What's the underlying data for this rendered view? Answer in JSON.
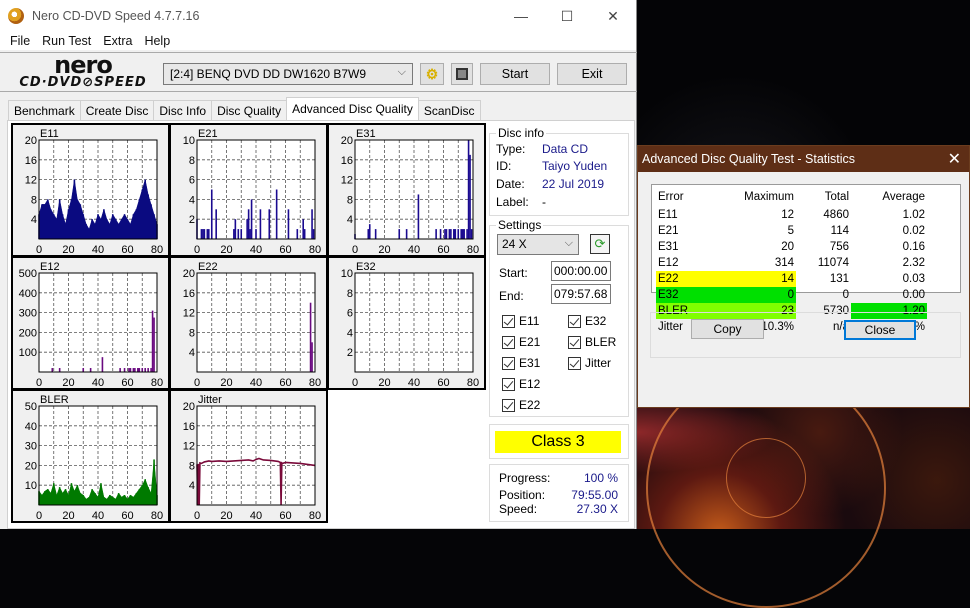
{
  "window": {
    "title": "Nero CD-DVD Speed 4.7.7.16",
    "minimize": "—",
    "maximize": "☐",
    "close": "✕"
  },
  "menu": [
    "File",
    "Run Test",
    "Extra",
    "Help"
  ],
  "logo": {
    "top": "nero",
    "bottom": "CD·DVD⊘SPEED"
  },
  "toolbar": {
    "drive": "[2:4]  BENQ DVD DD DW1620 B7W9",
    "start": "Start",
    "exit": "Exit",
    "icons": [
      "drive-settings-icon",
      "save-icon"
    ]
  },
  "tabs": [
    {
      "label": "Benchmark",
      "active": false
    },
    {
      "label": "Create Disc",
      "active": false
    },
    {
      "label": "Disc Info",
      "active": false
    },
    {
      "label": "Disc Quality",
      "active": false
    },
    {
      "label": "Advanced Disc Quality",
      "active": true
    },
    {
      "label": "ScanDisc",
      "active": false
    }
  ],
  "disc_info": {
    "title": "Disc info",
    "type_label": "Type:",
    "type": "Data CD",
    "id_label": "ID:",
    "id": "Taiyo Yuden",
    "date_label": "Date:",
    "date": "22 Jul 2019",
    "label_label": "Label:",
    "label": "-"
  },
  "settings": {
    "title": "Settings",
    "speed": "24 X",
    "start_label": "Start:",
    "start": "000:00.00",
    "end_label": "End:",
    "end": "079:57.68",
    "checks": [
      {
        "label": "E11",
        "checked": true
      },
      {
        "label": "E21",
        "checked": true
      },
      {
        "label": "E31",
        "checked": true
      },
      {
        "label": "E12",
        "checked": true
      },
      {
        "label": "E22",
        "checked": true
      },
      {
        "label": "E32",
        "checked": true
      },
      {
        "label": "BLER",
        "checked": true
      },
      {
        "label": "Jitter",
        "checked": true
      }
    ]
  },
  "class": {
    "label": "Class 3",
    "color": "#ffff00"
  },
  "progress": {
    "progress_label": "Progress:",
    "progress": "100 %",
    "position_label": "Position:",
    "position": "79:55.00",
    "speed_label": "Speed:",
    "speed": "27.30 X"
  },
  "dialog": {
    "title": "Advanced Disc Quality Test - Statistics",
    "close": "✕",
    "headers": [
      "Error",
      "Maximum",
      "Total",
      "Average"
    ],
    "rows": [
      {
        "name": "E11",
        "max": "12",
        "total": "4860",
        "avg": "1.02",
        "max_color": "",
        "avg_color": ""
      },
      {
        "name": "E21",
        "max": "5",
        "total": "114",
        "avg": "0.02",
        "max_color": "",
        "avg_color": ""
      },
      {
        "name": "E31",
        "max": "20",
        "total": "756",
        "avg": "0.16",
        "max_color": "",
        "avg_color": ""
      },
      {
        "name": "E12",
        "max": "314",
        "total": "11074",
        "avg": "2.32",
        "max_color": "",
        "avg_color": ""
      },
      {
        "name": "E22",
        "max": "14",
        "total": "131",
        "avg": "0.03",
        "max_color": "#ffff00",
        "avg_color": ""
      },
      {
        "name": "E32",
        "max": "0",
        "total": "0",
        "avg": "0.00",
        "max_color": "#00e000",
        "avg_color": ""
      },
      {
        "name": "BLER",
        "max": "23",
        "total": "5730",
        "avg": "1.20",
        "max_color": "#80ff00",
        "avg_color": "#00e000"
      },
      {
        "name": "Jitter",
        "max": "10.3%",
        "total": "n/a",
        "avg": "8.73%",
        "max_color": "",
        "avg_color": ""
      }
    ],
    "copy": "Copy",
    "close_btn": "Close"
  },
  "chart_data": [
    {
      "type": "bar",
      "title": "E11",
      "color": "#0a0a80",
      "xlim": [
        0,
        80
      ],
      "ylim": [
        0,
        20
      ],
      "xticks": [
        "0",
        "20",
        "40",
        "60",
        "80"
      ],
      "yticks": [
        "4",
        "8",
        "12",
        "16",
        "20"
      ],
      "x": [
        0,
        2,
        4,
        6,
        8,
        10,
        12,
        14,
        16,
        18,
        20,
        22,
        24,
        26,
        28,
        30,
        32,
        34,
        36,
        38,
        40,
        42,
        44,
        46,
        48,
        50,
        52,
        54,
        56,
        58,
        60,
        62,
        64,
        66,
        68,
        70,
        72,
        74,
        76,
        78,
        80
      ],
      "values": [
        5,
        7,
        7,
        8,
        6,
        5,
        4,
        8,
        5,
        3,
        6,
        8,
        12,
        8,
        7,
        5,
        3,
        2,
        4,
        3,
        5,
        4,
        6,
        4,
        3,
        5,
        4,
        3,
        4,
        5,
        4,
        3,
        5,
        6,
        8,
        10,
        12,
        9,
        7,
        5,
        3
      ]
    },
    {
      "type": "bar",
      "title": "E21",
      "color": "#1a0a90",
      "xlim": [
        0,
        80
      ],
      "ylim": [
        0,
        10
      ],
      "xticks": [
        "0",
        "20",
        "40",
        "60",
        "80"
      ],
      "yticks": [
        "2",
        "4",
        "6",
        "8",
        "10"
      ],
      "x": [
        0,
        3,
        4,
        5,
        7,
        8,
        10,
        13,
        25,
        26,
        28,
        30,
        34,
        35,
        36,
        37,
        40,
        43,
        49,
        54,
        62,
        68,
        72,
        73,
        78,
        79
      ],
      "values": [
        2,
        1,
        1,
        1,
        1,
        1,
        5,
        3,
        1,
        2,
        1,
        1,
        2,
        3,
        1,
        4,
        1,
        3,
        3,
        5,
        3,
        1,
        2,
        1,
        3,
        1
      ]
    },
    {
      "type": "bar",
      "title": "E31",
      "color": "#1a0a90",
      "xlim": [
        0,
        80
      ],
      "ylim": [
        0,
        20
      ],
      "xticks": [
        "0",
        "20",
        "40",
        "60",
        "80"
      ],
      "yticks": [
        "4",
        "8",
        "12",
        "16",
        "20"
      ],
      "x": [
        0,
        9,
        10,
        14,
        30,
        35,
        43,
        55,
        58,
        61,
        62,
        64,
        65,
        67,
        68,
        70,
        72,
        73,
        74,
        76,
        77,
        78,
        79
      ],
      "values": [
        1,
        2,
        3,
        2,
        2,
        2,
        9,
        2,
        2,
        2,
        2,
        2,
        2,
        2,
        2,
        2,
        2,
        2,
        2,
        2,
        20,
        17,
        2
      ]
    },
    {
      "type": "bar",
      "title": "E12",
      "color": "#6a0a80",
      "xlim": [
        0,
        80
      ],
      "ylim": [
        0,
        500
      ],
      "xticks": [
        "0",
        "20",
        "40",
        "60",
        "80"
      ],
      "yticks": [
        "100",
        "200",
        "300",
        "400",
        "500"
      ],
      "x": [
        9,
        14,
        30,
        35,
        43,
        55,
        58,
        61,
        62,
        64,
        65,
        67,
        68,
        70,
        72,
        74,
        76,
        77,
        78
      ],
      "values": [
        20,
        20,
        20,
        20,
        75,
        20,
        20,
        20,
        20,
        20,
        20,
        20,
        20,
        20,
        20,
        20,
        20,
        310,
        275
      ]
    },
    {
      "type": "bar",
      "title": "E22",
      "color": "#6a0a80",
      "xlim": [
        0,
        80
      ],
      "ylim": [
        0,
        20
      ],
      "xticks": [
        "0",
        "20",
        "40",
        "60",
        "80"
      ],
      "yticks": [
        "4",
        "8",
        "12",
        "16",
        "20"
      ],
      "x": [
        77,
        78
      ],
      "values": [
        14,
        6
      ]
    },
    {
      "type": "bar",
      "title": "E32",
      "color": "#1a0a90",
      "xlim": [
        0,
        80
      ],
      "ylim": [
        0,
        10
      ],
      "xticks": [
        "0",
        "20",
        "40",
        "60",
        "80"
      ],
      "yticks": [
        "2",
        "4",
        "6",
        "8",
        "10"
      ],
      "x": [],
      "values": []
    },
    {
      "type": "bar",
      "title": "BLER",
      "color": "#007a00",
      "xlim": [
        0,
        80
      ],
      "ylim": [
        0,
        50
      ],
      "xticks": [
        "0",
        "20",
        "40",
        "60",
        "80"
      ],
      "yticks": [
        "10",
        "20",
        "30",
        "40",
        "50"
      ],
      "x": [
        0,
        2,
        4,
        6,
        8,
        10,
        12,
        14,
        16,
        18,
        20,
        22,
        24,
        26,
        28,
        30,
        32,
        34,
        36,
        38,
        40,
        42,
        44,
        46,
        48,
        50,
        52,
        54,
        56,
        58,
        60,
        62,
        64,
        66,
        68,
        70,
        72,
        74,
        76,
        78,
        80
      ],
      "values": [
        7,
        5,
        7,
        8,
        6,
        11,
        5,
        9,
        6,
        8,
        5,
        11,
        7,
        10,
        6,
        5,
        3,
        4,
        8,
        6,
        4,
        11,
        4,
        3,
        5,
        4,
        3,
        6,
        4,
        5,
        3,
        5,
        4,
        6,
        8,
        10,
        13,
        9,
        6,
        23,
        5
      ]
    },
    {
      "type": "line",
      "title": "Jitter",
      "color": "#7a0a3a",
      "xlim": [
        0,
        80
      ],
      "ylim": [
        0,
        20
      ],
      "xticks": [
        "0",
        "20",
        "40",
        "60",
        "80"
      ],
      "yticks": [
        "4",
        "8",
        "12",
        "16",
        "20"
      ],
      "x": [
        0,
        0.5,
        1,
        1.5,
        2,
        3,
        5,
        8,
        10,
        15,
        20,
        25,
        30,
        35,
        38,
        40,
        42,
        45,
        50,
        55,
        56.5,
        57,
        57.5,
        58,
        60,
        65,
        70,
        75,
        80
      ],
      "values": [
        8.2,
        0,
        8.3,
        0,
        8.5,
        8.4,
        8.7,
        8.9,
        8.8,
        8.9,
        8.8,
        8.9,
        9.0,
        9.1,
        8.9,
        9.2,
        9.4,
        9.1,
        9.0,
        8.8,
        8.6,
        0,
        8.5,
        8.4,
        8.6,
        8.5,
        8.4,
        8.2,
        8.0
      ]
    }
  ]
}
